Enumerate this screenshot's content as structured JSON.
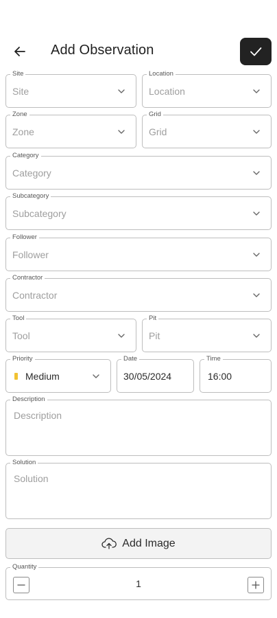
{
  "header": {
    "title": "Add Observation",
    "back_icon": "arrow-left-icon",
    "save_icon": "check-icon",
    "save_color": "#222222"
  },
  "form": {
    "site": {
      "label": "Site",
      "placeholder": "Site"
    },
    "location": {
      "label": "Location",
      "placeholder": "Location"
    },
    "zone": {
      "label": "Zone",
      "placeholder": "Zone"
    },
    "grid": {
      "label": "Grid",
      "placeholder": "Grid"
    },
    "category": {
      "label": "Category",
      "placeholder": "Category"
    },
    "subcategory": {
      "label": "Subcategory",
      "placeholder": "Subcategory"
    },
    "follower": {
      "label": "Follower",
      "placeholder": "Follower"
    },
    "contractor": {
      "label": "Contractor",
      "placeholder": "Contractor"
    },
    "tool": {
      "label": "Tool",
      "placeholder": "Tool"
    },
    "pit": {
      "label": "Pit",
      "placeholder": "Pit"
    },
    "priority": {
      "label": "Priority",
      "value": "Medium",
      "color": "#f1c232"
    },
    "date": {
      "label": "Date",
      "value": "30/05/2024"
    },
    "time": {
      "label": "Time",
      "value": "16:00"
    },
    "description": {
      "label": "Description",
      "placeholder": "Description"
    },
    "solution": {
      "label": "Solution",
      "placeholder": "Solution"
    },
    "add_image": {
      "label": "Add Image",
      "icon": "cloud-upload-icon"
    },
    "quantity": {
      "label": "Quantity",
      "value": "1",
      "minus_icon": "minus-icon",
      "plus_icon": "plus-icon"
    }
  }
}
